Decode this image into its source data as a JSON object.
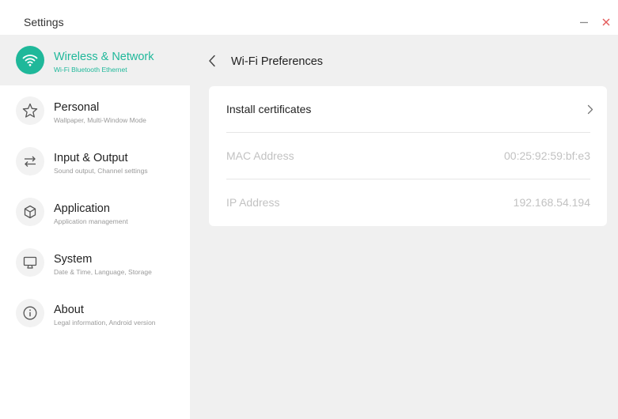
{
  "window": {
    "title": "Settings",
    "minimize_icon": "minus-icon",
    "close_icon": "close-icon"
  },
  "colors": {
    "accent": "#1fb89a",
    "close": "#e45b5b",
    "main_bg": "#f0f0f0"
  },
  "sidebar": {
    "items": [
      {
        "label": "Wireless & Network",
        "sub": "Wi-Fi Bluetooth Ethernet",
        "icon": "wifi-icon",
        "selected": true
      },
      {
        "label": "Personal",
        "sub": "Wallpaper, Multi-Window Mode",
        "icon": "star-icon",
        "selected": false
      },
      {
        "label": "Input & Output",
        "sub": "Sound output, Channel settings",
        "icon": "swap-arrows-icon",
        "selected": false
      },
      {
        "label": "Application",
        "sub": "Application management",
        "icon": "cube-icon",
        "selected": false
      },
      {
        "label": "System",
        "sub": "Date & Time, Language, Storage",
        "icon": "monitor-icon",
        "selected": false
      },
      {
        "label": "About",
        "sub": "Legal information, Android version",
        "icon": "info-icon",
        "selected": false
      }
    ]
  },
  "main": {
    "back_icon": "chevron-left-icon",
    "title": "Wi-Fi Preferences",
    "rows": [
      {
        "label": "Install certificates",
        "value": "",
        "enabled": true,
        "icon": "chevron-right-icon"
      },
      {
        "label": "MAC Address",
        "value": "00:25:92:59:bf:e3",
        "enabled": false
      },
      {
        "label": "IP Address",
        "value": "192.168.54.194",
        "enabled": false
      }
    ]
  }
}
